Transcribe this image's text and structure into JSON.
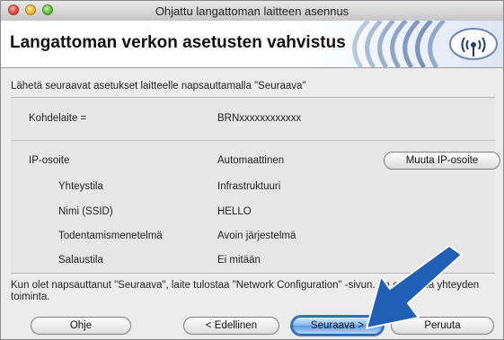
{
  "window": {
    "title": "Ohjattu langattoman laitteen asennus"
  },
  "banner": {
    "title": "Langattoman verkon asetusten vahvistus",
    "logo_icon": "wireless-wifi-icon"
  },
  "instruction": "Lähetä seuraavat asetukset laitteelle napsauttamalla \"Seuraava\"",
  "settings": {
    "target_label": "Kohdelaite =",
    "target_value": "BRNxxxxxxxxxxxx",
    "ip_label": "IP-osoite",
    "ip_value": "Automaattinen",
    "change_ip_button": "Muuta IP-osoite",
    "mode_label": "Yhteystila",
    "mode_value": "Infrastruktuuri",
    "ssid_label": "Nimi (SSID)",
    "ssid_value": "HELLO",
    "auth_label": "Todentamismenetelmä",
    "auth_value": "Avoin järjestelmä",
    "enc_label": "Salaustila",
    "enc_value": "Ei mitään"
  },
  "footer_text": "Kun olet napsauttanut \"Seuraava\", laite tulostaa \"Network Configuration\" -sivun. Va          en avulla yhteyden toiminta.",
  "buttons": {
    "help": "Ohje",
    "back": "< Edellinen",
    "next": "Seuraava >",
    "cancel": "Peruuta"
  },
  "colors": {
    "accent": "#3a7bd5",
    "arrow": "#1f5fb5"
  }
}
